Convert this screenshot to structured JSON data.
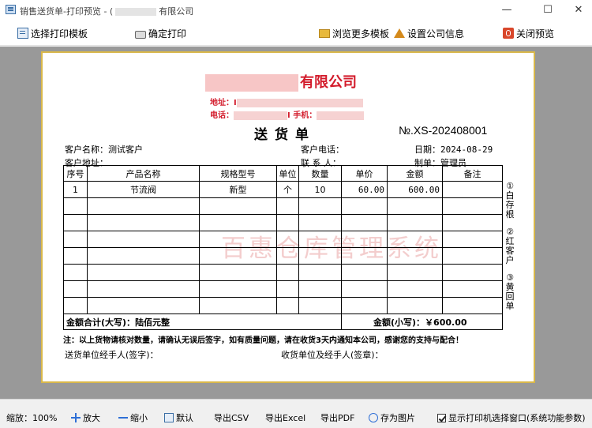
{
  "window": {
    "title_prefix": "销售送货单-打印预览 - (",
    "title_suffix": "有限公司",
    "minimize": "—",
    "maximize": "☐",
    "close": "✕"
  },
  "toolbar": {
    "select_template": "选择打印模板",
    "confirm_print": "确定打印",
    "browse_templates": "浏览更多模板",
    "set_company": "设置公司信息",
    "close_preview": "关闭预览"
  },
  "document": {
    "company_suffix": "有限公司",
    "address_label": "地址：",
    "address_hint": "I",
    "phone_label": "电话：",
    "phone_hint": "I",
    "mobile_label": "手机：",
    "title": "送货单",
    "number": "№.XS-202408001",
    "customer_name_label": "客户名称：",
    "customer_name": "测试客户",
    "customer_phone_label": "客户电话：",
    "date_label": "日期：",
    "date": "2024-08-29",
    "customer_address_label": "客户地址：",
    "contact_label": "联 系 人：",
    "maker_label": "制单：",
    "maker": "管理员",
    "table_headers": [
      "序号",
      "产品名称",
      "规格型号",
      "单位",
      "数量",
      "单价",
      "金额",
      "备注"
    ],
    "rows": [
      [
        "1",
        "节流阀",
        "新型",
        "个",
        "10",
        "60.00",
        "600.00",
        ""
      ]
    ],
    "total_upper_label": "金额合计(大写)：",
    "total_upper": "陆佰元整",
    "total_lower_label": "金额(小写)：",
    "total_lower": "￥600.00",
    "watermark": "百惠仓库管理系统",
    "side_copies": [
      "①白存根",
      "②红客户",
      "③黄回单"
    ],
    "note": "注：以上货物请核对数量，请确认无误后签字，如有质量问题，请在收货3天内通知本公司，感谢您的支持与配合！",
    "sender_sign": "送货单位经手人(签字)：",
    "receiver_sign": "收货单位及经手人(签章)："
  },
  "statusbar": {
    "zoom": "缩放：100%",
    "zoom_in": "放大",
    "zoom_out": "缩小",
    "default": "默认",
    "export_csv": "导出CSV",
    "export_excel": "导出Excel",
    "export_pdf": "导出PDF",
    "save_image": "存为图片",
    "show_printer_dialog": "显示打印机选择窗口(系统功能参数)"
  }
}
